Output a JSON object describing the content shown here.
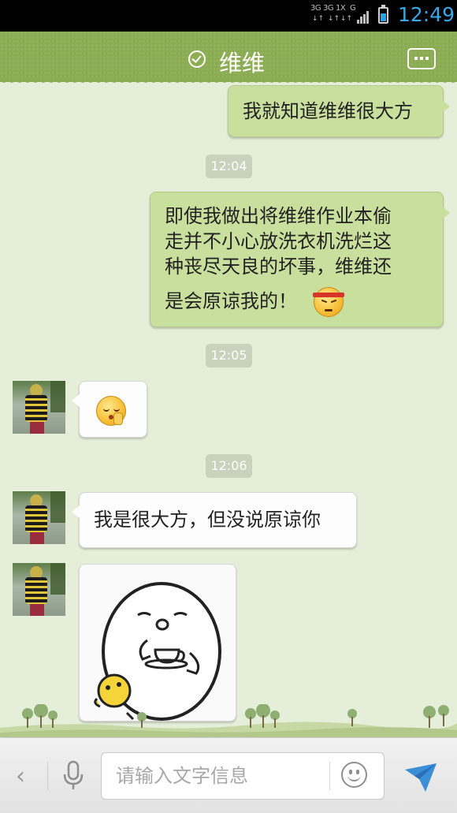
{
  "status_bar": {
    "network_1": "3G",
    "network_2": "3G",
    "network_3": "1X",
    "network_4": "G",
    "time": "12:49",
    "battery_level": 0.6,
    "accent_color": "#38a8e6"
  },
  "header": {
    "title": "维维",
    "verified_icon": "check-circle-icon",
    "more_icon": "more-dots-icon",
    "background_color": "#8bac52"
  },
  "messages": [
    {
      "type": "sent",
      "text": "我就知道维维很大方"
    },
    {
      "type": "timestamp",
      "text": "12:04"
    },
    {
      "type": "sent",
      "lines": [
        "即使我做出将维维作业本偷",
        "走并不小心放洗衣机洗烂这",
        "种丧尽天良的坏事，维维还",
        "是会原谅我的！"
      ],
      "emoji": "angry-headband-face"
    },
    {
      "type": "timestamp",
      "text": "12:05"
    },
    {
      "type": "received",
      "emoji": "shush-face"
    },
    {
      "type": "timestamp",
      "text": "12:06"
    },
    {
      "type": "received",
      "text": "我是很大方，但没说原谅你"
    },
    {
      "type": "received",
      "sticker": "blob-drinking-tea-sticker"
    }
  ],
  "input_bar": {
    "placeholder": "请输入文字信息",
    "value": "",
    "back_icon": "chevron-left-icon",
    "voice_icon": "microphone-icon",
    "emoji_icon": "smiley-icon",
    "send_icon": "send-plane-icon"
  },
  "colors": {
    "chat_background": "#e4eed9",
    "sent_bubble": "#c9df9d",
    "received_bubble": "#fdfdfd"
  }
}
